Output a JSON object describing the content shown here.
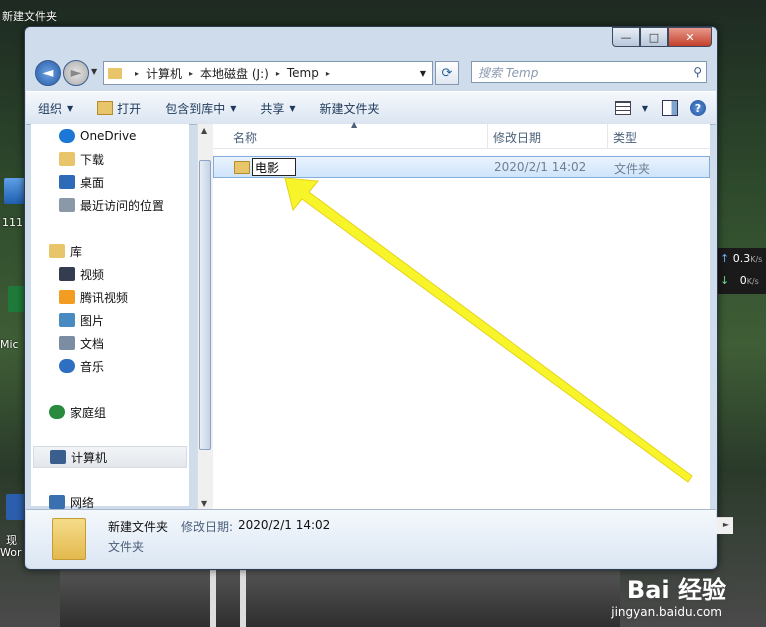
{
  "desktop": {
    "title": "新建文件夹",
    "icon_labels": [
      "111",
      "Mic",
      "现",
      "Wor"
    ],
    "net_up": "0.3",
    "net_down": "0",
    "net_unit": "K/s"
  },
  "watermark": {
    "text": "Bai 经验",
    "sub": "jingyan.baidu.com"
  },
  "window": {
    "caption_buttons": {
      "minimize": "—",
      "maximize": "□",
      "close": "✕"
    },
    "nav": {
      "back": "◄",
      "forward": "►",
      "dropdown": "▼"
    },
    "address": {
      "segments": [
        "计算机",
        "本地磁盘 (J:)",
        "Temp"
      ],
      "separator": "▸",
      "dropdown": "▼"
    },
    "refresh": "⟳",
    "search": {
      "placeholder": "搜索 Temp",
      "icon": "⚲"
    },
    "toolbar": {
      "organize": "组织",
      "open": "打开",
      "include_library": "包含到库中",
      "share": "共享",
      "new_folder": "新建文件夹",
      "help": "?"
    },
    "nav_pane": {
      "items": [
        {
          "label": "OneDrive",
          "icon": "cloud-icon",
          "color": "#1b78d6"
        },
        {
          "label": "下载",
          "icon": "downloads-icon",
          "color": "#e8c46a"
        },
        {
          "label": "桌面",
          "icon": "desktop-icon",
          "color": "#2d6bb8"
        },
        {
          "label": "最近访问的位置",
          "icon": "recent-places-icon",
          "color": "#8a98a8"
        },
        {
          "label": "库",
          "icon": "libraries-icon",
          "color": "#e8c46a"
        },
        {
          "label": "视频",
          "icon": "video-icon",
          "color": "#333d4f"
        },
        {
          "label": "腾讯视频",
          "icon": "tencent-video-icon",
          "color": "#f39c22"
        },
        {
          "label": "图片",
          "icon": "pictures-icon",
          "color": "#4a8ac2"
        },
        {
          "label": "文档",
          "icon": "documents-icon",
          "color": "#7b8da3"
        },
        {
          "label": "音乐",
          "icon": "music-icon",
          "color": "#2f6fc2"
        },
        {
          "label": "家庭组",
          "icon": "homegroup-icon",
          "color": "#2a8b3e"
        },
        {
          "label": "计算机",
          "icon": "computer-icon",
          "color": "#3a5f8f"
        },
        {
          "label": "网络",
          "icon": "network-icon",
          "color": "#3a6fb0"
        }
      ]
    },
    "columns": {
      "name": "名称",
      "date": "修改日期",
      "type": "类型"
    },
    "files": [
      {
        "name": "电影",
        "date": "2020/2/1 14:02",
        "type": "文件夹"
      }
    ],
    "details": {
      "name": "新建文件夹",
      "date_label": "修改日期:",
      "date_value": "2020/2/1 14:02",
      "type": "文件夹"
    }
  },
  "annotation": {
    "arrow_color": "#f7f52a"
  }
}
